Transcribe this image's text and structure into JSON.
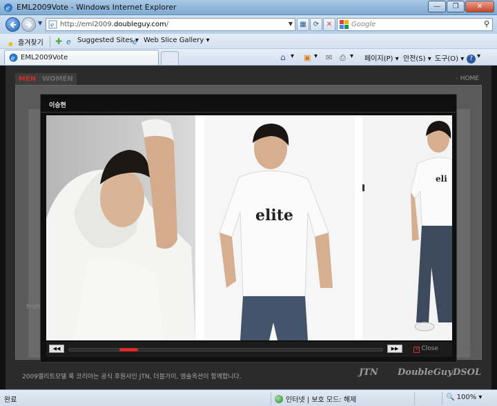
{
  "window": {
    "title": "EML2009Vote - Windows Internet Explorer",
    "minimize": "—",
    "restore": "❐",
    "close": "✕"
  },
  "address": {
    "url_prefix": "http://eml2009.",
    "url_domain": "doubleguy.com",
    "url_suffix": "/",
    "search_placeholder": "Google"
  },
  "favorites": {
    "favorites_label": "즐겨찾기",
    "suggested_sites": "Suggested Sites ▾",
    "web_slice": "Web Slice Gallery ▾"
  },
  "tab": {
    "label": "EML2009Vote"
  },
  "commands": {
    "page": "페이지(P) ▾",
    "safety": "안전(S) ▾",
    "tools": "도구(O) ▾",
    "help": "▾"
  },
  "site": {
    "tab_men": "MEN",
    "tab_women": "WOMEN",
    "home": "HOME",
    "profile_text": "Profi",
    "room_text": "oom",
    "footer": "2009엘리트모델 룩 코리아는 공식 후원사인 JTN, 더블가이, 엠솔옥션이 함께합니다.",
    "logos": [
      "JTN",
      "DoubleGuy",
      "DSOL"
    ]
  },
  "lightbox": {
    "model_name": "이승현",
    "prev": "◀◀",
    "next": "▶▶",
    "close_label": "Close",
    "close_icon": "✕",
    "scroll_position": 0.16,
    "scroll_width": 0.06,
    "shirt_logo": "elite"
  },
  "status": {
    "left": "완료",
    "zone": "인터넷 | 보호 모드: 해제",
    "zoom": "100%"
  },
  "colors": {
    "accent_red": "#c0322b",
    "scroll_thumb": "#e02a2a"
  }
}
